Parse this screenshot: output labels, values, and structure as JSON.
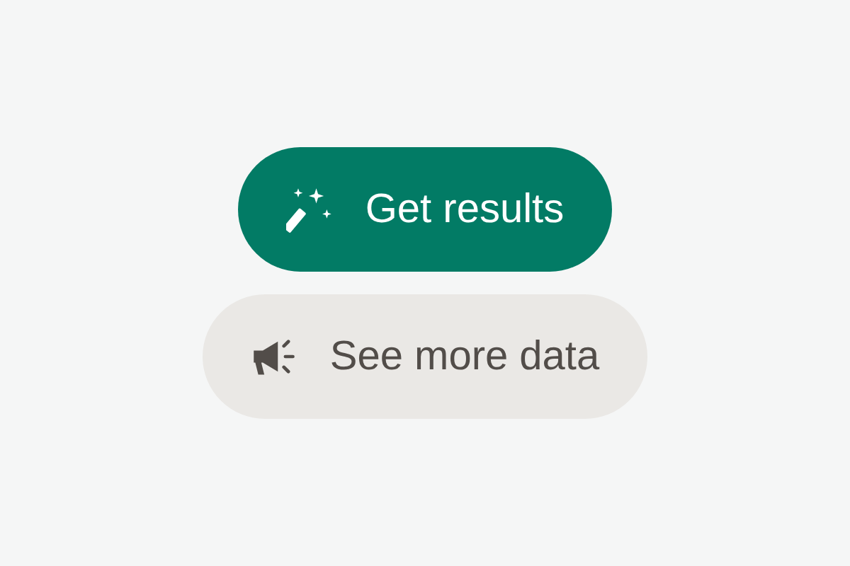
{
  "buttons": [
    {
      "label": "Get results",
      "kind": "primary"
    },
    {
      "label": "See more data",
      "kind": "secondary"
    }
  ]
}
